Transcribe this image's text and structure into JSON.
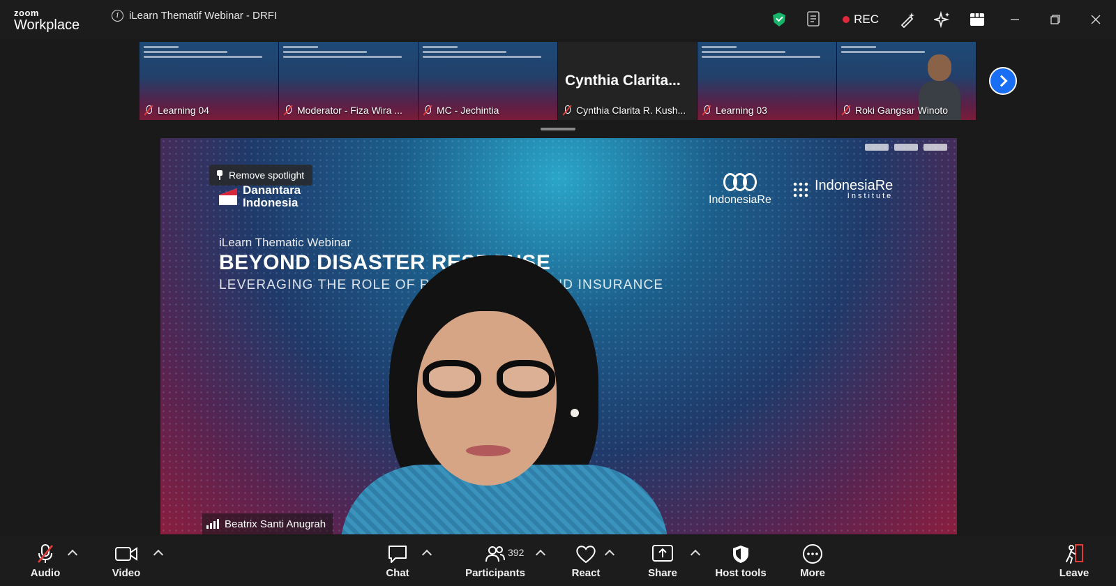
{
  "app": {
    "brand_top": "zoom",
    "brand_bottom": "Workplace"
  },
  "meeting": {
    "title": "iLearn Thematif Webinar - DRFI"
  },
  "recording": {
    "label": "REC",
    "color": "#e0283b"
  },
  "security_color": "#16b56b",
  "thumbnails": [
    {
      "name": "Learning 04",
      "muted": true,
      "type": "slide"
    },
    {
      "name": "Moderator - Fiza Wira ...",
      "muted": true,
      "type": "slide"
    },
    {
      "name": "MC - Jechintia",
      "muted": true,
      "type": "slide"
    },
    {
      "name": "Cynthia Clarita R. Kush...",
      "display_name": "Cynthia  Clarita...",
      "muted": true,
      "type": "name"
    },
    {
      "name": "Learning 03",
      "muted": true,
      "type": "slide"
    },
    {
      "name": "Roki Gangsar Winoto",
      "muted": true,
      "type": "video"
    }
  ],
  "stage": {
    "spotlight_label": "Remove spotlight",
    "logo_left_line1": "Danantara",
    "logo_left_line2": "Indonesia",
    "logo_right1": "IndonesiaRe",
    "logo_right2_line1": "IndonesiaRe",
    "logo_right2_line2": "Institute",
    "webinar_subtitle": "iLearn Thematic Webinar",
    "webinar_title": "BEYOND DISASTER RESPONSE",
    "webinar_tagline": "LEVERAGING THE ROLE OF RISK FINANCING AND INSURANCE",
    "speaker_name": "Beatrix Santi Anugrah"
  },
  "toolbar": {
    "audio": "Audio",
    "video": "Video",
    "chat": "Chat",
    "participants": "Participants",
    "participants_count": "392",
    "react": "React",
    "share": "Share",
    "host_tools": "Host tools",
    "more": "More",
    "leave": "Leave"
  }
}
